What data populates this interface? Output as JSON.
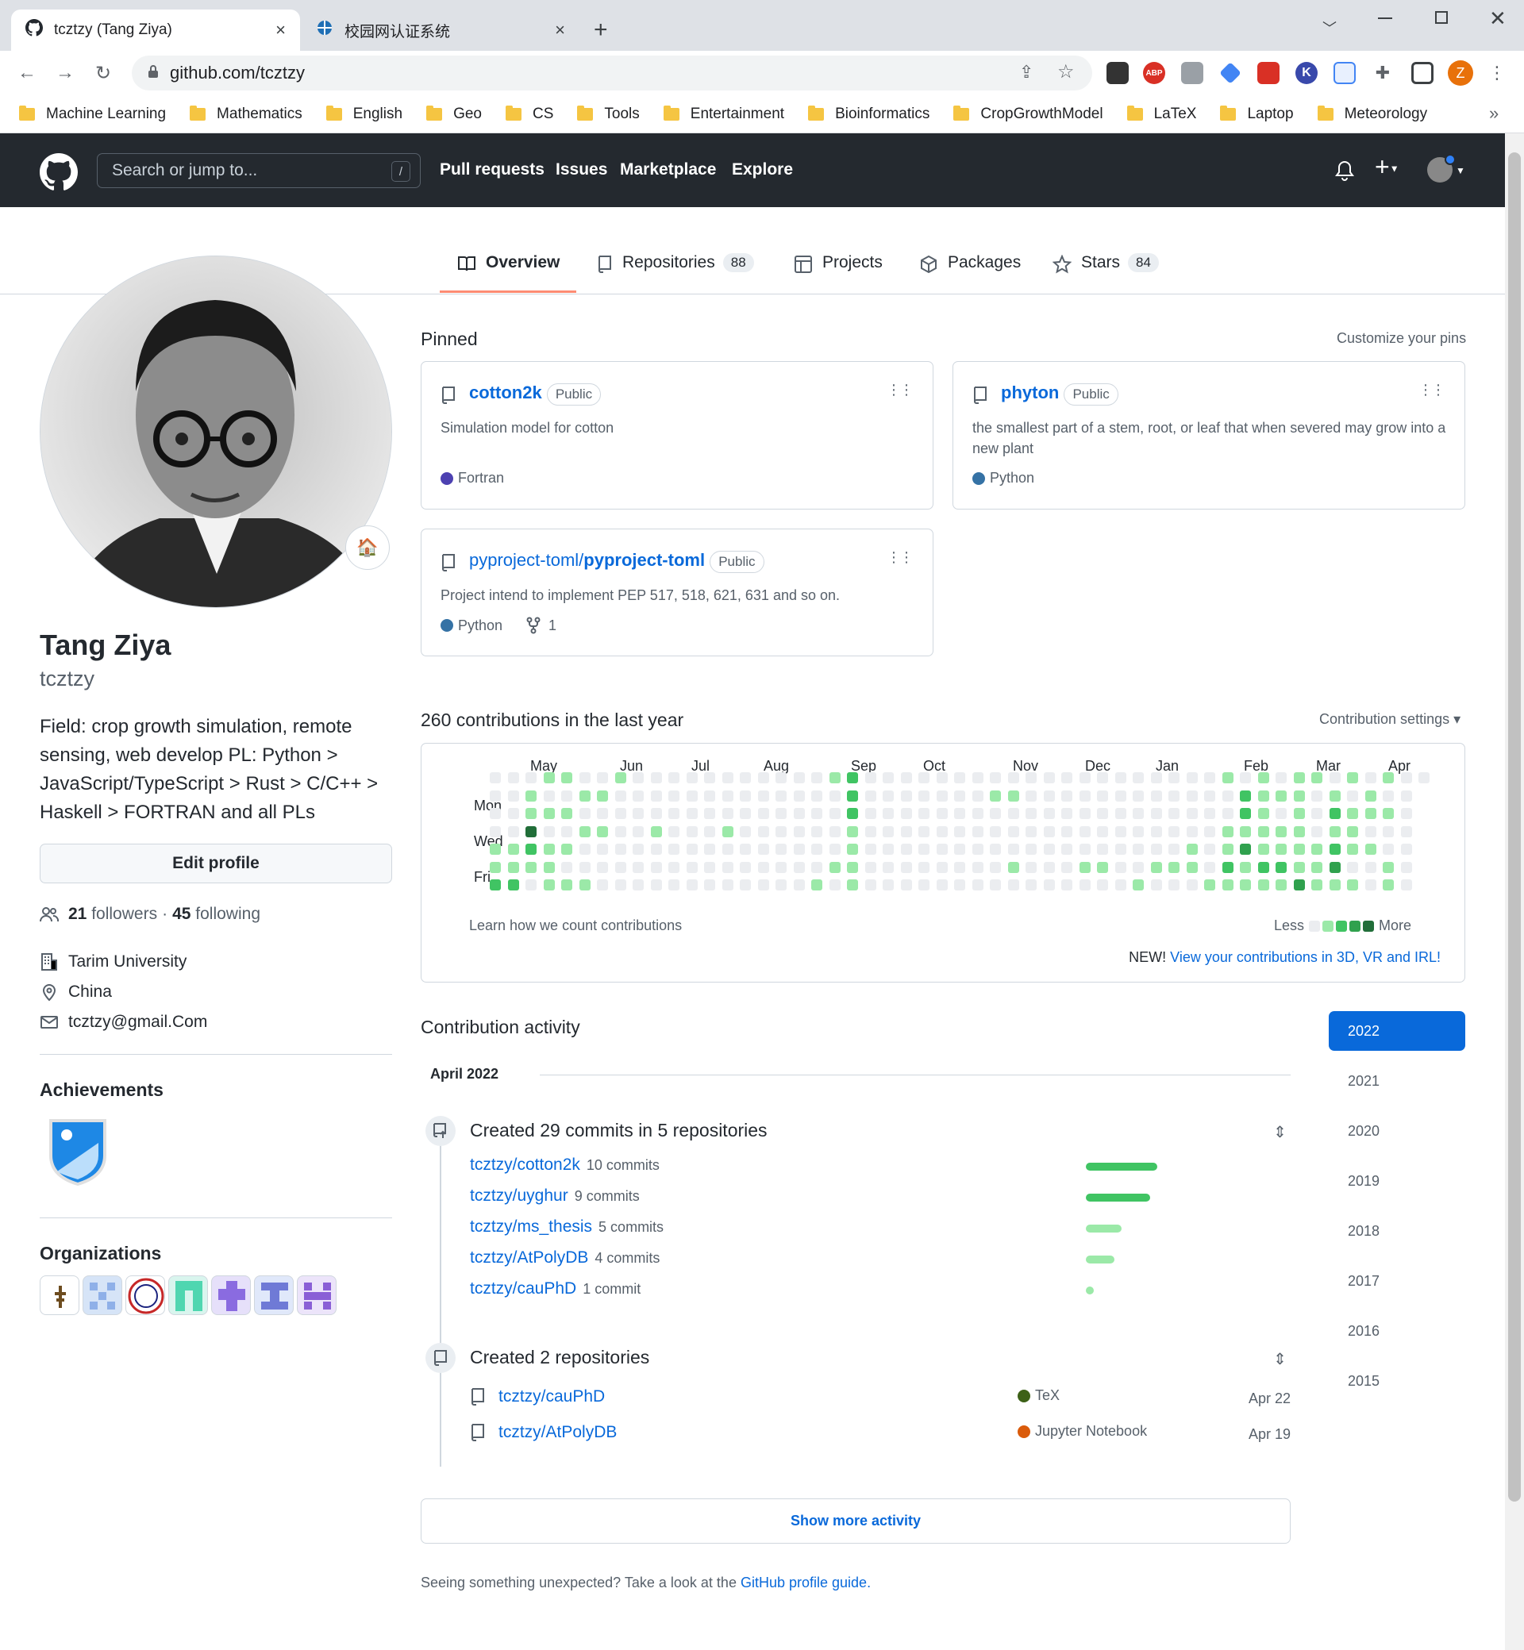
{
  "browser": {
    "tabs": [
      {
        "title": "tcztzy (Tang Ziya)",
        "close": "×"
      },
      {
        "title": "校园网认证系统",
        "close": "×"
      }
    ],
    "new_tab": "+",
    "address": "github.com/tcztzy",
    "profile_initial": "Z",
    "bookmarks": [
      "Machine Learning",
      "Mathematics",
      "English",
      "Geo",
      "CS",
      "Tools",
      "Entertainment",
      "Bioinformatics",
      "CropGrowthModel",
      "LaTeX",
      "Laptop",
      "Meteorology"
    ],
    "bookmarks_more": "»",
    "colors": {
      "frame": "#dee1e6",
      "profile": "#e8710a"
    }
  },
  "header": {
    "search_placeholder": "Search or jump to...",
    "search_shortcut": "/",
    "nav": [
      "Pull requests",
      "Issues",
      "Marketplace",
      "Explore"
    ],
    "plus": "+"
  },
  "profile_tabs": [
    {
      "label": "Overview",
      "count": ""
    },
    {
      "label": "Repositories",
      "count": "88"
    },
    {
      "label": "Projects",
      "count": ""
    },
    {
      "label": "Packages",
      "count": ""
    },
    {
      "label": "Stars",
      "count": "84"
    }
  ],
  "profile": {
    "name": "Tang Ziya",
    "login": "tcztzy",
    "status_emoji": "🏠",
    "bio": "Field: crop growth simulation, remote sensing, web develop PL: Python > JavaScript/TypeScript > Rust > C/C++ > Haskell > FORTRAN and all PLs",
    "edit_profile": "Edit profile",
    "followers": "21",
    "followers_label": "followers",
    "sep": "·",
    "following": "45",
    "following_label": "following",
    "company": "Tarim University",
    "location": "China",
    "email": "tcztzy@gmail.Com",
    "achievements_title": "Achievements",
    "organizations_title": "Organizations"
  },
  "pinned": {
    "title": "Pinned",
    "customize": "Customize your pins",
    "cards": [
      {
        "name": "cotton2k",
        "owner": "",
        "visibility": "Public",
        "description": "Simulation model for cotton",
        "language": "Fortran",
        "lang_color": "#4d41b1",
        "forks": ""
      },
      {
        "name": "phyton",
        "owner": "",
        "visibility": "Public",
        "description": "the smallest part of a stem, root, or leaf that when severed may grow into a new plant",
        "language": "Python",
        "lang_color": "#3572A5",
        "forks": ""
      },
      {
        "name": "pyproject-toml",
        "owner": "pyproject-toml/",
        "visibility": "Public",
        "description": "Project intend to implement PEP 517, 518, 621, 631 and so on.",
        "language": "Python",
        "lang_color": "#3572A5",
        "forks": "1"
      }
    ]
  },
  "contributions": {
    "title": "260 contributions in the last year",
    "settings": "Contribution settings ▾",
    "months": [
      "May",
      "Jun",
      "Jul",
      "Aug",
      "Sep",
      "Oct",
      "Nov",
      "Dec",
      "Jan",
      "Feb",
      "Mar",
      "Apr"
    ],
    "day_labels": [
      "Mon",
      "Wed",
      "Fri"
    ],
    "learn": "Learn how we count contributions",
    "less": "Less",
    "more": "More",
    "new_prefix": "NEW!",
    "new_link": "View your contributions in 3D, VR and IRL!",
    "level_colors": [
      "#ebedf0",
      "#9be9a8",
      "#40c463",
      "#30a14e",
      "#216e39"
    ]
  },
  "activity": {
    "title": "Contribution activity",
    "month": "April 2022",
    "years": [
      "2022",
      "2021",
      "2020",
      "2019",
      "2018",
      "2017",
      "2016",
      "2015"
    ],
    "commits_title": "Created 29 commits in 5 repositories",
    "commits": [
      {
        "repo": "tcztzy/cotton2k",
        "count": "10 commits",
        "value": 10
      },
      {
        "repo": "tcztzy/uyghur",
        "count": "9 commits",
        "value": 9
      },
      {
        "repo": "tcztzy/ms_thesis",
        "count": "5 commits",
        "value": 5
      },
      {
        "repo": "tcztzy/AtPolyDB",
        "count": "4 commits",
        "value": 4
      },
      {
        "repo": "tcztzy/cauPhD",
        "count": "1 commit",
        "value": 1
      }
    ],
    "repos_title": "Created 2 repositories",
    "repos": [
      {
        "repo": "tcztzy/cauPhD",
        "language": "TeX",
        "lang_color": "#3D6117",
        "date": "Apr 22"
      },
      {
        "repo": "tcztzy/AtPolyDB",
        "language": "Jupyter Notebook",
        "lang_color": "#DA5B0B",
        "date": "Apr 19"
      }
    ],
    "show_more": "Show more activity",
    "footer_text": "Seeing something unexpected? Take a look at the",
    "footer_link": "GitHub profile guide",
    "footer_end": "."
  }
}
